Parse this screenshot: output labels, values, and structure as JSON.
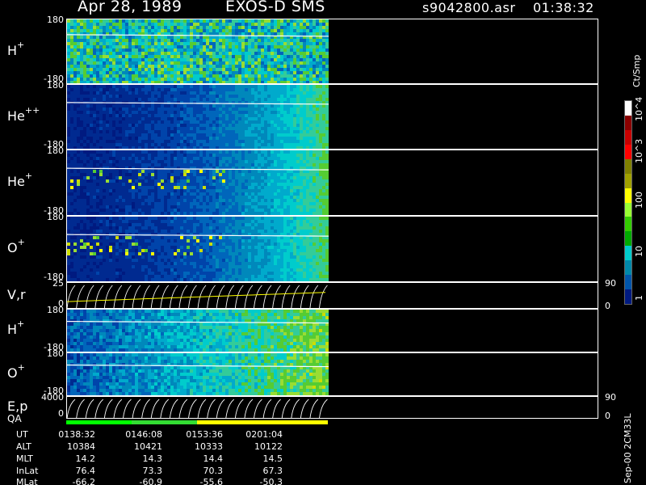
{
  "header": {
    "date": "Apr 28, 1989",
    "instrument": "EXOS-D SMS",
    "file": "s9042800.asr",
    "time": "01:38:32"
  },
  "panels": [
    {
      "id": "h-plus-pitch",
      "species": "H",
      "charge": "+",
      "y_top": "180",
      "y_bottom": "-180",
      "type": "spectrogram"
    },
    {
      "id": "he-plusplus-pitch",
      "species": "He",
      "charge": "++",
      "y_top": "180",
      "y_bottom": "-180",
      "type": "spectrogram"
    },
    {
      "id": "he-plus-pitch",
      "species": "He",
      "charge": "+",
      "y_top": "180",
      "y_bottom": "-180",
      "type": "spectrogram"
    },
    {
      "id": "o-plus-pitch",
      "species": "O",
      "charge": "+",
      "y_top": "180",
      "y_bottom": "-180",
      "type": "spectrogram"
    },
    {
      "id": "vr-line",
      "species": "V,r",
      "charge": "",
      "y_top": "25",
      "y_bottom": "0",
      "right_top": "90",
      "right_bottom": "0",
      "type": "line"
    },
    {
      "id": "h-plus-2",
      "species": "H",
      "charge": "+",
      "y_top": "180",
      "y_bottom": "-180",
      "type": "spectrogram"
    },
    {
      "id": "o-plus-2",
      "species": "O",
      "charge": "+",
      "y_top": "180",
      "y_bottom": "-180",
      "type": "spectrogram"
    },
    {
      "id": "ep-line",
      "species": "E,p",
      "charge": "",
      "y_top": "4000",
      "y_bottom": "0",
      "right_top": "90",
      "right_bottom": "0",
      "type": "line"
    }
  ],
  "qa": {
    "label": "QA",
    "colors": [
      "#00ff00",
      "#33dd33",
      "#ffff00",
      "#ffff00"
    ]
  },
  "ephemeris": {
    "labels": [
      "UT",
      "ALT",
      "MLT",
      "InLat",
      "MLat"
    ],
    "columns": [
      [
        "0138:32",
        "10384",
        "14.2",
        "76.4",
        "-66.2"
      ],
      [
        "0146:08",
        "10421",
        "14.3",
        "73.3",
        "-60.9"
      ],
      [
        "0153:36",
        "10333",
        "14.4",
        "70.3",
        "-55.6"
      ],
      [
        "0201:04",
        "10122",
        "14.5",
        "67.3",
        "-50.3"
      ]
    ]
  },
  "colorbar": {
    "unit": "Ct/Smp",
    "tick_labels": [
      "10^4",
      "10^3",
      "100",
      "10",
      "1"
    ],
    "colors": [
      "#ffffff",
      "#8b0000",
      "#c80000",
      "#ff0000",
      "#808000",
      "#a0a000",
      "#ffff00",
      "#99ff33",
      "#33cc00",
      "#00aa00",
      "#00cccc",
      "#0088aa",
      "#0055aa",
      "#001a80"
    ]
  },
  "footer_label": "Sep-00 2CM33L",
  "chart_data": {
    "type": "heatmap",
    "title": "Apr 28, 1989 EXOS-D SMS",
    "x_ticks": [
      "0138:32",
      "0146:08",
      "0153:36",
      "0201:04"
    ],
    "y_range": [
      -180,
      180
    ],
    "data_coverage_fraction": 0.49,
    "colorscale": [
      "1",
      "10",
      "100",
      "10^3",
      "10^4"
    ]
  }
}
